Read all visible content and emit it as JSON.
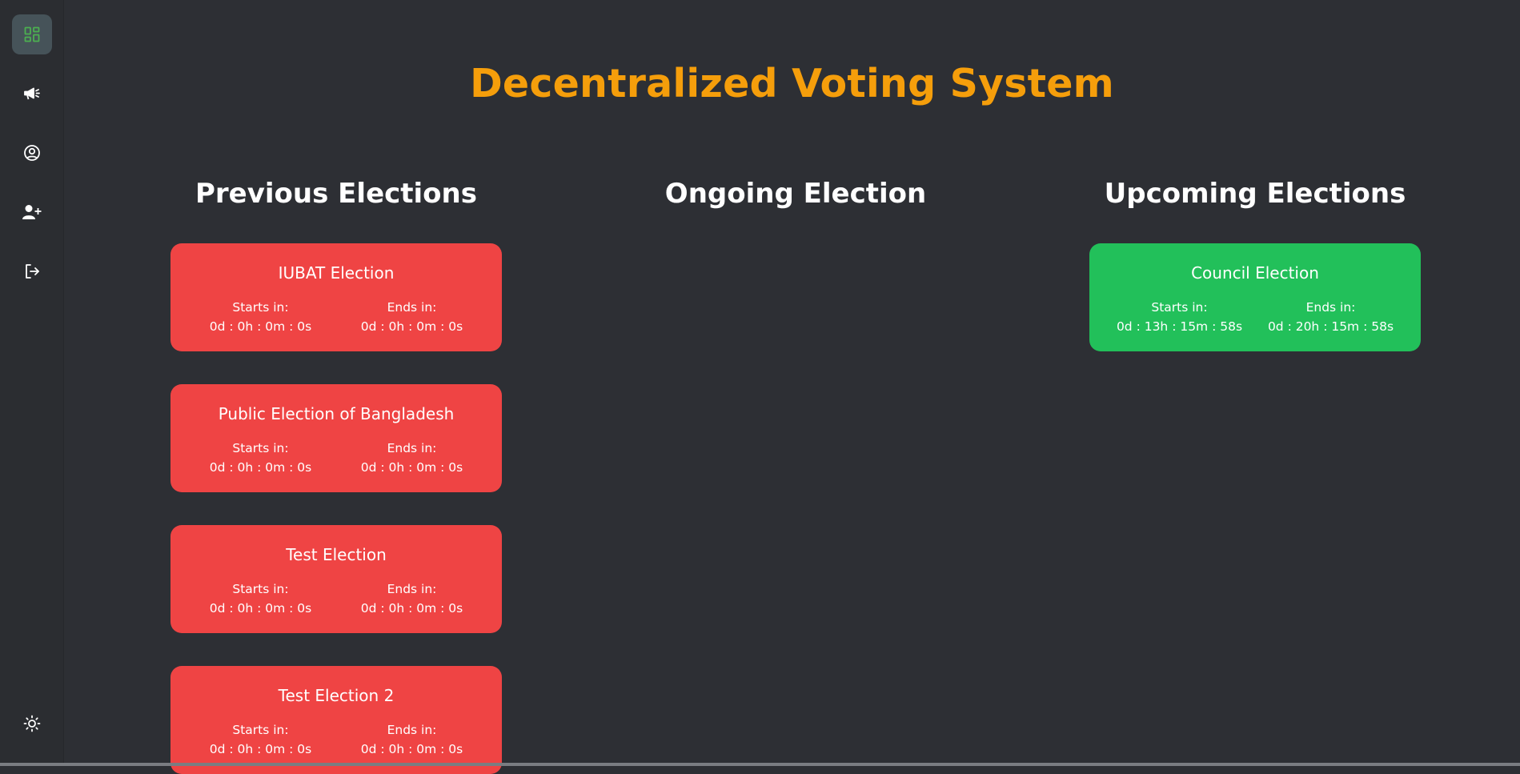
{
  "sidebar": {
    "items": [
      {
        "name": "dashboard",
        "icon": "dashboard-grid-icon",
        "active": true
      },
      {
        "name": "announcements",
        "icon": "megaphone-icon",
        "active": false
      },
      {
        "name": "profile",
        "icon": "user-circle-icon",
        "active": false
      },
      {
        "name": "add-user",
        "icon": "user-plus-icon",
        "active": false
      },
      {
        "name": "logout",
        "icon": "logout-icon",
        "active": false
      }
    ],
    "theme_toggle_icon": "sun-icon",
    "accent_color": "#4caf50"
  },
  "header": {
    "title": "Decentralized Voting System",
    "title_color": "#f59e0b"
  },
  "columns": {
    "previous": {
      "title": "Previous Elections",
      "card_color": "#ef4444",
      "elections": [
        {
          "name": "IUBAT Election",
          "starts_label": "Starts in:",
          "starts_value": "0d : 0h : 0m : 0s",
          "ends_label": "Ends in:",
          "ends_value": "0d : 0h : 0m : 0s"
        },
        {
          "name": "Public Election of Bangladesh",
          "starts_label": "Starts in:",
          "starts_value": "0d : 0h : 0m : 0s",
          "ends_label": "Ends in:",
          "ends_value": "0d : 0h : 0m : 0s"
        },
        {
          "name": "Test Election",
          "starts_label": "Starts in:",
          "starts_value": "0d : 0h : 0m : 0s",
          "ends_label": "Ends in:",
          "ends_value": "0d : 0h : 0m : 0s"
        },
        {
          "name": "Test Election 2",
          "starts_label": "Starts in:",
          "starts_value": "0d : 0h : 0m : 0s",
          "ends_label": "Ends in:",
          "ends_value": "0d : 0h : 0m : 0s"
        }
      ]
    },
    "ongoing": {
      "title": "Ongoing Election",
      "elections": []
    },
    "upcoming": {
      "title": "Upcoming Elections",
      "card_color": "#22c05a",
      "elections": [
        {
          "name": "Council Election",
          "starts_label": "Starts in:",
          "starts_value": "0d : 13h : 15m : 58s",
          "ends_label": "Ends in:",
          "ends_value": "0d : 20h : 15m : 58s"
        }
      ]
    }
  }
}
